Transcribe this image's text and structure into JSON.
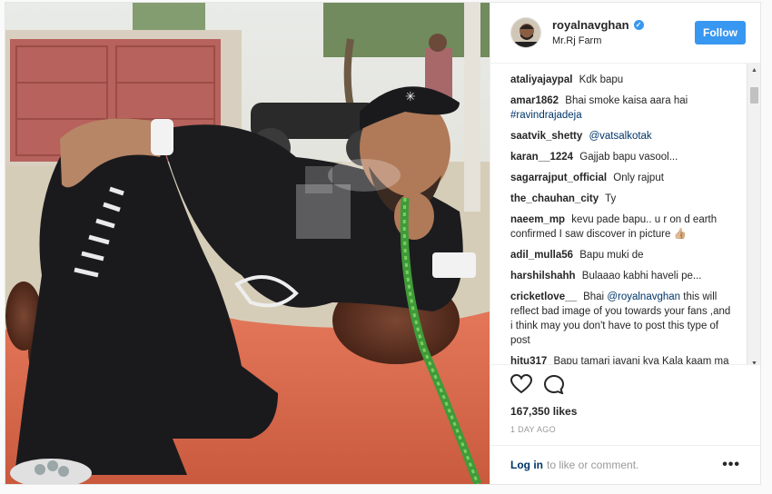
{
  "header": {
    "username": "royalnavghan",
    "verified_icon": "verified-badge-icon",
    "location": "Mr.Rj Farm",
    "follow_label": "Follow",
    "accent_color": "#3897f0"
  },
  "comments": [
    {
      "user": "ataliyajaypal",
      "text": "Kdk bapu"
    },
    {
      "user": "amar1862",
      "text": "Bhai smoke kaisa aara hai",
      "mention": "#ravindrajadeja"
    },
    {
      "user": "saatvik_shetty",
      "text": "",
      "mention": "@vatsalkotak"
    },
    {
      "user": "karan__1224",
      "text": "Gajjab bapu vasool..."
    },
    {
      "user": "sagarrajput_official",
      "text": "Only rajput"
    },
    {
      "user": "the_chauhan_city",
      "text": "Ty"
    },
    {
      "user": "naeem_mp",
      "text": "kevu pade bapu.. u r on d earth confirmed I saw discover in picture 👍🏼"
    },
    {
      "user": "adil_mulla56",
      "text": "Bapu muki de"
    },
    {
      "user": "harshilshahh",
      "text": "Bulaaao kabhi haveli pe..."
    },
    {
      "user": "cricketlove__",
      "text_before": "Bhai",
      "mention": "@royalnavghan",
      "text_after": "this will reflect bad image of you towards your fans ,and i think may you don't have to post this type of post"
    },
    {
      "user": "hitu317",
      "text": "Bapu tamari javani kya Kala kaam ma che??? 😅😅😅"
    }
  ],
  "actions": {
    "like_icon": "heart-icon",
    "comment_icon": "comment-bubble-icon",
    "likes": "167,350 likes",
    "time_ago": "1 DAY AGO"
  },
  "footer": {
    "login_label": "Log in",
    "login_rest": "to like or comment.",
    "more_icon": "more-options-icon",
    "more_label": "•••"
  }
}
